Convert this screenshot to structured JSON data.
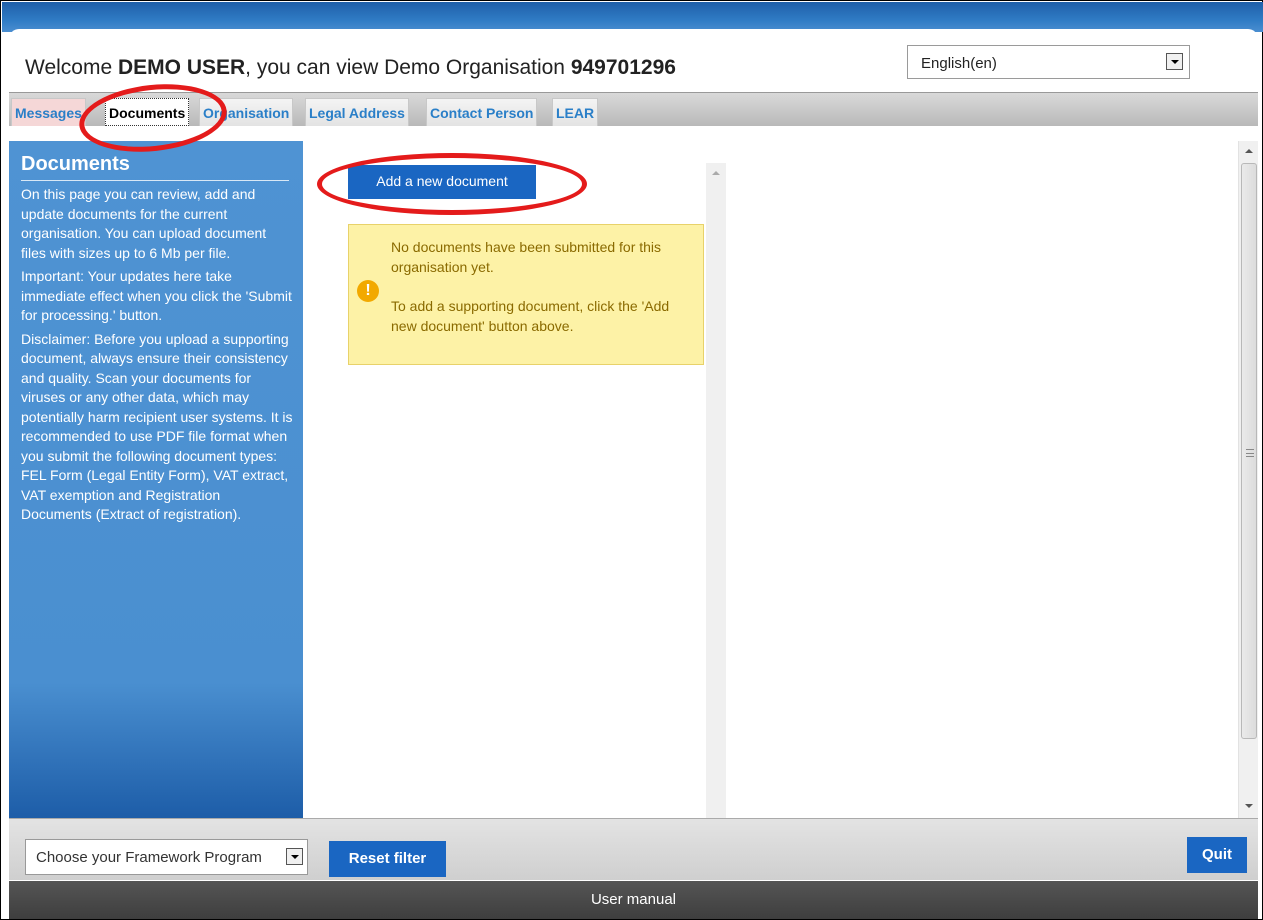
{
  "header": {
    "welcome_prefix": "Welcome ",
    "user_name": "DEMO USER",
    "welcome_middle": ", you can view Demo Organisation ",
    "org_id": "949701296",
    "language": "English(en)"
  },
  "tabs": [
    {
      "label": "Messages"
    },
    {
      "label": "Documents"
    },
    {
      "label": "Organisation"
    },
    {
      "label": "Legal Address"
    },
    {
      "label": "Contact Person"
    },
    {
      "label": "LEAR"
    }
  ],
  "sidebar": {
    "title": "Documents",
    "paragraphs": [
      "On this page you can review, add and update documents for the current organisation. You can upload document files with sizes up to 6 Mb per file.",
      "Important: Your updates here take immediate effect when you click the 'Submit for processing.' button.",
      "Disclaimer: Before you upload a supporting document, always ensure their consistency and quality. Scan your documents for viruses or any other data, which may potentially harm recipient user systems. It is recommended to use PDF file format when you submit the following document types: FEL Form (Legal Entity Form), VAT extract, VAT exemption and Registration Documents (Extract of registration)."
    ]
  },
  "main": {
    "add_button": "Add a new document",
    "notice_line1": "No documents have been submitted for this organisation yet.",
    "notice_line2": "To add a supporting document, click the 'Add new document' button above."
  },
  "bottom": {
    "framework_placeholder": "Choose your Framework Program",
    "reset_label": "Reset filter",
    "quit_label": "Quit"
  },
  "footer": {
    "user_manual": "User manual"
  },
  "colors": {
    "accent": "#1a66c2",
    "sidebar": "#4a8fd0",
    "annotation": "#e41b1b"
  }
}
